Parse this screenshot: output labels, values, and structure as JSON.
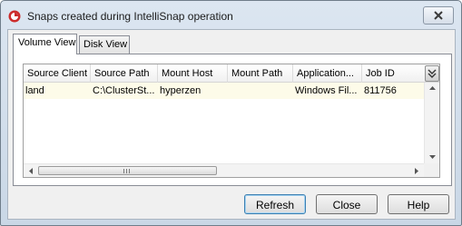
{
  "window": {
    "title": "Snaps created during IntelliSnap operation",
    "close_label": "Close window"
  },
  "tabs": [
    {
      "label": "Volume View",
      "active": true
    },
    {
      "label": "Disk View",
      "active": false
    }
  ],
  "table": {
    "columns": [
      "Source Client",
      "Source Path",
      "Mount Host",
      "Mount Path",
      "Application...",
      "Job ID"
    ],
    "rows": [
      [
        "land",
        "C:\\ClusterSt...",
        "hyperzen",
        "",
        "Windows Fil...",
        "811756"
      ]
    ]
  },
  "buttons": {
    "refresh": "Refresh",
    "close": "Close",
    "help": "Help"
  },
  "colors": {
    "accent": "#cc2b2b",
    "row_highlight": "#fdfbe9"
  }
}
